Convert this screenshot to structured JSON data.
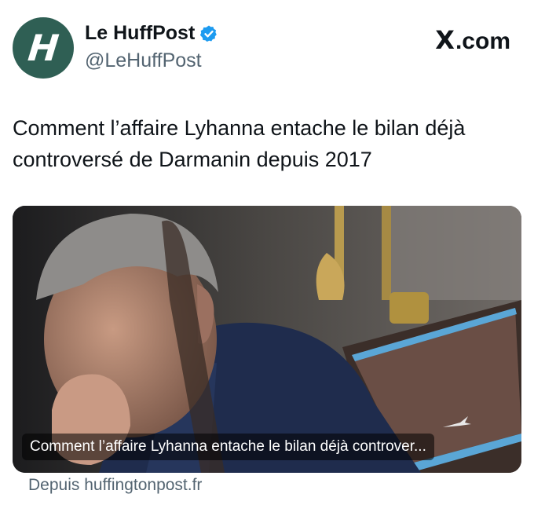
{
  "account": {
    "display_name": "Le HuffPost",
    "handle": "@LeHuffPost",
    "avatar_letter": "H",
    "avatar_color": "#2f5f54",
    "verified_icon": "verified-badge-icon",
    "verified_color": "#1d9bf0"
  },
  "site": {
    "logo_letter": "X",
    "logo_suffix": ".com"
  },
  "tweet": {
    "text": "Comment l’affaire Lyhanna entache le bilan déjà controversé de Darmanin depuis 2017"
  },
  "link_card": {
    "image_icon": "news-photo",
    "caption": "Comment l’affaire Lyhanna entache le bilan déjà controver...",
    "source": "Depuis huffingtonpost.fr"
  }
}
